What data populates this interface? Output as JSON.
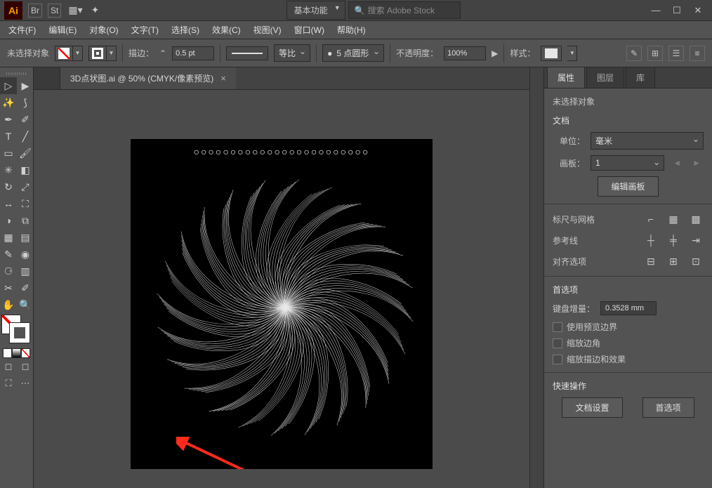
{
  "titlebar": {
    "app": "Ai",
    "icons": [
      "Br",
      "St"
    ],
    "workspace": "基本功能",
    "search_placeholder": "搜索 Adobe Stock"
  },
  "menu": {
    "items": [
      "文件(F)",
      "编辑(E)",
      "对象(O)",
      "文字(T)",
      "选择(S)",
      "效果(C)",
      "视图(V)",
      "窗口(W)",
      "帮助(H)"
    ]
  },
  "control": {
    "no_sel": "未选择对象",
    "stroke_label": "描边：",
    "stroke_weight": "0.5 pt",
    "uniform": "等比",
    "dot5": "5 点圆形",
    "opacity_label": "不透明度：",
    "opacity_val": "100%",
    "style_label": "样式："
  },
  "doc": {
    "tab_title": "3D点状图.ai @ 50% (CMYK/像素预览)",
    "circles": "○○○○○○○○○○○○○○○○○○○○○○○○"
  },
  "panel": {
    "tabs": [
      "属性",
      "图层",
      "库"
    ],
    "no_sel": "未选择对象",
    "doc_label": "文档",
    "unit_label": "单位：",
    "unit_val": "毫米",
    "artboard_label": "画板：",
    "artboard_val": "1",
    "edit_artboard_btn": "编辑画板",
    "rulers_label": "标尺与网格",
    "guides_label": "参考线",
    "align_label": "对齐选项",
    "prefs_label": "首选项",
    "key_inc_label": "键盘增量：",
    "key_inc_val": "0.3528 mm",
    "chk1": "使用预览边界",
    "chk2": "缩放边角",
    "chk3": "缩放描边和效果",
    "quick_label": "快速操作",
    "doc_setup_btn": "文档设置",
    "prefs_btn": "首选项"
  }
}
